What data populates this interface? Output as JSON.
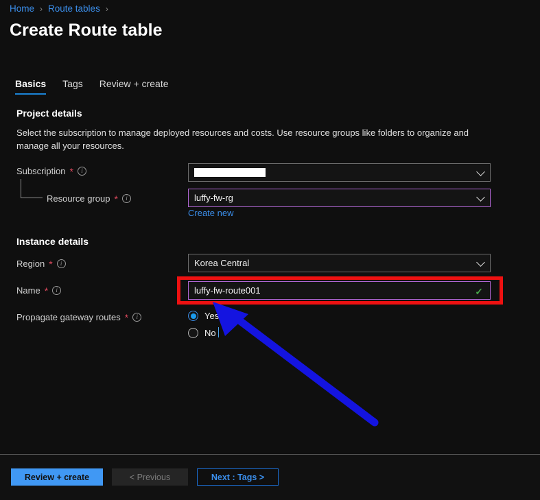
{
  "breadcrumb": {
    "items": [
      {
        "label": "Home"
      },
      {
        "label": "Route tables"
      }
    ],
    "separator": "›"
  },
  "page_title": "Create Route table",
  "tabs": [
    {
      "label": "Basics",
      "active": true
    },
    {
      "label": "Tags",
      "active": false
    },
    {
      "label": "Review + create",
      "active": false
    }
  ],
  "project_details": {
    "heading": "Project details",
    "description": "Select the subscription to manage deployed resources and costs. Use resource groups like folders to organize and manage all your resources.",
    "subscription": {
      "label": "Subscription",
      "required_marker": "*",
      "info_glyph": "i",
      "value": "",
      "redacted": true,
      "chevron": "chevron-down"
    },
    "resource_group": {
      "label": "Resource group",
      "required_marker": "*",
      "info_glyph": "i",
      "value": "luffy-fw-rg",
      "focused": true,
      "create_new_link": "Create new",
      "chevron": "chevron-down"
    }
  },
  "instance_details": {
    "heading": "Instance details",
    "region": {
      "label": "Region",
      "required_marker": "*",
      "info_glyph": "i",
      "value": "Korea Central",
      "chevron": "chevron-down"
    },
    "name": {
      "label": "Name",
      "required_marker": "*",
      "info_glyph": "i",
      "value": "luffy-fw-route001",
      "focused": true,
      "validation_glyph": "✓",
      "validation_color": "#45a347"
    },
    "propagate_gateway_routes": {
      "label": "Propagate gateway routes",
      "required_marker": "*",
      "info_glyph": "i",
      "selected": "Yes",
      "options": [
        {
          "label": "Yes",
          "checked": true
        },
        {
          "label": "No",
          "checked": false
        }
      ]
    }
  },
  "footer": {
    "review_create_label": "Review + create",
    "previous_label": "< Previous",
    "next_label": "Next : Tags >"
  },
  "annotations": {
    "highlight_rect_color": "#ee1111",
    "arrow_color": "#1414e0"
  },
  "colors": {
    "background": "#0f0f0f",
    "accent_blue": "#3b8eea",
    "primary_button": "#4098f4",
    "focus_border": "#b267d6",
    "required_star": "#e04a5f",
    "tab_underline": "#1b83d6"
  }
}
